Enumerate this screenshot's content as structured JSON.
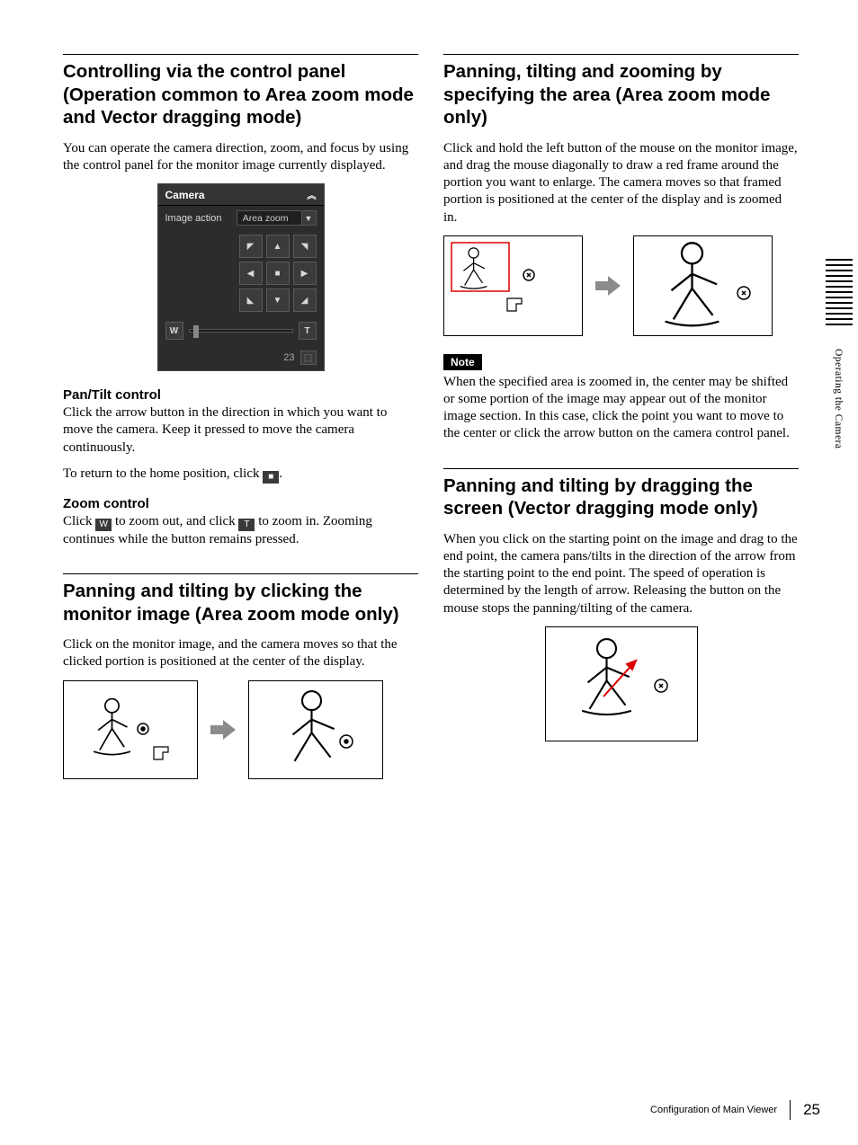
{
  "left": {
    "h1": "Controlling via the control panel (Operation common to Area zoom mode and Vector dragging mode)",
    "p1": "You can operate the camera direction, zoom, and focus by using the control panel for the monitor image currently displayed.",
    "panel": {
      "title": "Camera",
      "rowLabel": "Image action",
      "mode": "Area zoom",
      "zoomOut": "W",
      "zoomIn": "T",
      "status": "23"
    },
    "sub1": "Pan/Tilt control",
    "sub1p1": "Click the arrow button in the direction in which you want to move the camera. Keep it pressed to move the camera continuously.",
    "sub1p2a": "To return to the home position, click ",
    "sub1p2b": ".",
    "sub2": "Zoom control",
    "sub2p1a": "Click ",
    "sub2p1b": " to zoom out, and click ",
    "sub2p1c": " to zoom in. Zooming continues while the button remains pressed.",
    "h2": "Panning and tilting by clicking the monitor image (Area zoom mode only)",
    "p2": "Click on the monitor image, and the camera moves so that the clicked portion is positioned at the center of the display."
  },
  "right": {
    "h1": "Panning, tilting and zooming by specifying the area (Area zoom mode only)",
    "p1": "Click and hold the left button of the mouse on the monitor image, and drag the mouse diagonally to draw a red frame around the portion you want to enlarge. The camera moves so that framed portion is positioned at the center of the display and is zoomed in.",
    "note": "Note",
    "notep": "When the specified area is zoomed in, the center may be shifted or some portion of the image may appear out of the monitor image section. In this case, click the point you want to move to the center or click the arrow button on the camera control panel.",
    "h2": "Panning and tilting by dragging the screen (Vector dragging mode only)",
    "p2": "When you click on the starting point on the image and drag to the end point, the camera pans/tilts in the direction of the arrow from the starting point to the end point. The speed of operation is determined by the length of arrow. Releasing the button on the mouse stops the panning/tilting of the camera."
  },
  "sideTab": "Operating the Camera",
  "footer": {
    "text": "Configuration of Main Viewer",
    "page": "25"
  },
  "icons": {
    "home": "■",
    "w": "W",
    "t": "T"
  }
}
